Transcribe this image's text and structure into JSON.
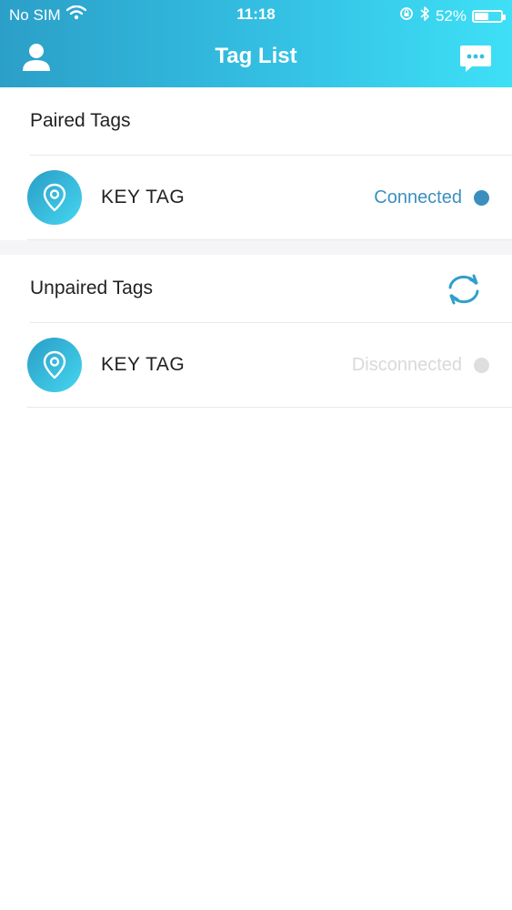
{
  "status_bar": {
    "carrier": "No SIM",
    "time": "11:18",
    "battery": "52%",
    "battery_level": 0.52
  },
  "nav": {
    "title": "Tag List"
  },
  "paired": {
    "title": "Paired Tags",
    "items": [
      {
        "name": "KEY TAG",
        "status": "Connected",
        "status_color": "#3b8fbf",
        "dot_color": "#3b8fbf"
      }
    ]
  },
  "unpaired": {
    "title": "Unpaired Tags",
    "items": [
      {
        "name": "KEY TAG",
        "status": "Disconnected",
        "status_color": "#d9d9d9",
        "dot_color": "#dedede"
      }
    ]
  },
  "colors": {
    "header_start": "#2b9fc8",
    "header_end": "#3ee0f6",
    "accent": "#3b8fbf"
  }
}
